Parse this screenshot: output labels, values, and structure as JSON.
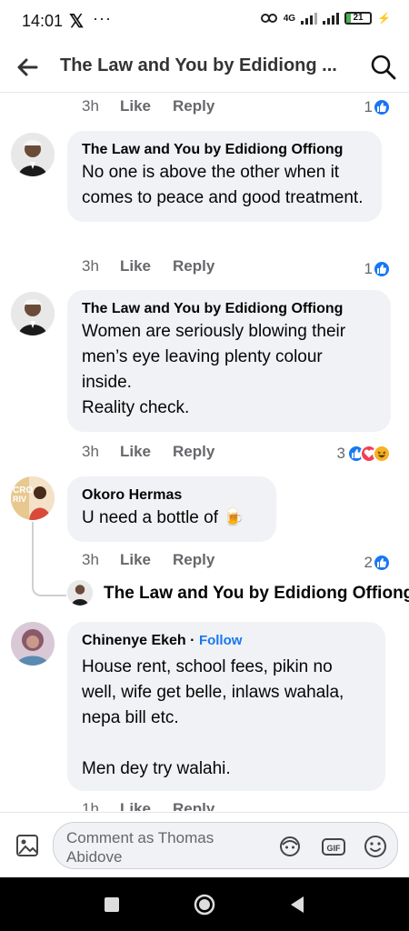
{
  "status": {
    "time": "14:01",
    "x_glyph": "𝕏",
    "dots": "···",
    "network": "4G",
    "battery": "21"
  },
  "header": {
    "title": "The Law and You by Edidiong ..."
  },
  "comments": [
    {
      "time": "3h",
      "like": "Like",
      "reply": "Reply",
      "reactions": "1"
    },
    {
      "author": "The Law and You by Edidiong Offiong",
      "text": "No one is above the other when it comes to peace and good treatment.",
      "time": "3h",
      "like": "Like",
      "reply": "Reply",
      "reactions": "1"
    },
    {
      "author": "The Law and You by Edidiong Offiong",
      "text": "Women are seriously blowing their men’s eye leaving plenty colour inside.\nReality check.",
      "time": "3h",
      "like": "Like",
      "reply": "Reply",
      "reactions": "3"
    },
    {
      "author": "Okoro Hermas",
      "text": "U need  a bottle of 🍺",
      "time": "3h",
      "like": "Like",
      "reply": "Reply",
      "reactions": "2"
    },
    {
      "author": "Chinenye Ekeh",
      "follow": "Follow",
      "text": "House rent, school fees, pikin no well, wife get belle, inlaws wahala, nepa bill etc.\n\nMen dey try walahi.",
      "time": "1h",
      "like": "Like",
      "reply": "Reply"
    }
  ],
  "reply_preview": {
    "author": "The Law and You by Edidiong Offiong"
  },
  "composer": {
    "placeholder": "Comment as Thomas Abidove"
  },
  "colors": {
    "accent": "#1877f2",
    "bubble": "#f0f2f5",
    "meta": "#65676b"
  }
}
